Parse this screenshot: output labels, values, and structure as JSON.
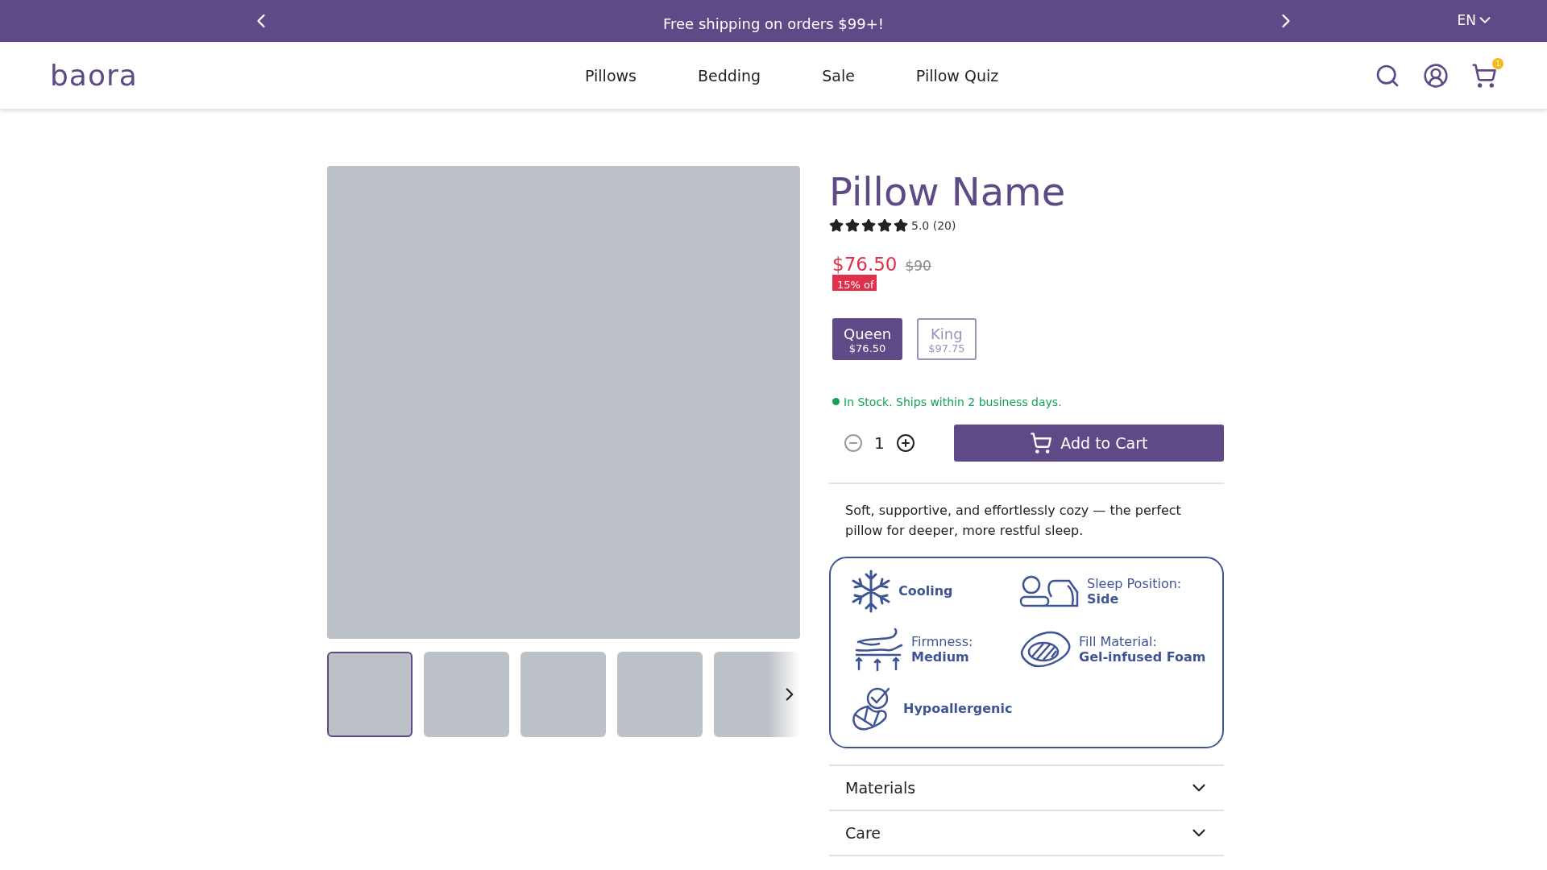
{
  "announcement": {
    "text": "Free shipping on orders $99+!",
    "language": "EN"
  },
  "nav": {
    "logo": "baora",
    "links": [
      "Pillows",
      "Bedding",
      "Sale",
      "Pillow Quiz"
    ],
    "cart_count": "1"
  },
  "gallery": {
    "thumbnails": [
      {
        "selected": true
      },
      {
        "selected": false
      },
      {
        "selected": false
      },
      {
        "selected": false
      },
      {
        "selected": false
      }
    ]
  },
  "product": {
    "title": "Pillow Name",
    "stars": 5,
    "rating": "5.0 (20)",
    "price": "$76.50",
    "original_price": "$90",
    "discount": "15% of",
    "sizes": [
      {
        "name": "Queen",
        "price": "$76.50",
        "selected": true
      },
      {
        "name": "King",
        "price": "$97.75",
        "selected": false
      }
    ],
    "stock": "In Stock. Ships within 2 business days.",
    "quantity": "1",
    "add_to_cart": "Add to Cart",
    "description": "Soft, supportive, and effortlessly cozy — the perfect pillow for deeper, more restful sleep.",
    "features": [
      {
        "kind": "single",
        "label": "Cooling"
      },
      {
        "kind": "labeled",
        "label": "Sleep Position:",
        "value": "Side"
      },
      {
        "kind": "labeled",
        "label": "Firmness:",
        "value": "Medium"
      },
      {
        "kind": "labeled",
        "label": "Fill Material:",
        "value": "Gel-infused Foam"
      },
      {
        "kind": "single",
        "label": "Hypoallergenic"
      }
    ],
    "accordions": [
      {
        "title": "Materials",
        "expanded": false
      },
      {
        "title": "Care",
        "expanded": false
      }
    ]
  }
}
